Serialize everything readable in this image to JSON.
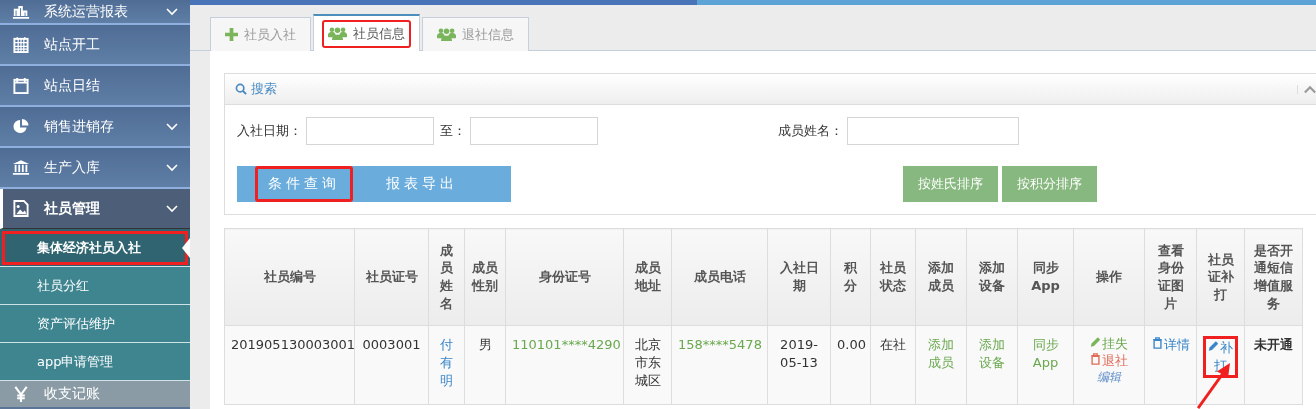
{
  "sidebar": {
    "items": [
      {
        "label": "系统运营报表",
        "expandable": true,
        "expanded": false
      },
      {
        "label": "站点开工",
        "expandable": false,
        "expanded": false
      },
      {
        "label": "站点日结",
        "expandable": false,
        "expanded": false
      },
      {
        "label": "销售进销存",
        "expandable": true,
        "expanded": false
      },
      {
        "label": "生产入库",
        "expandable": true,
        "expanded": false
      },
      {
        "label": "社员管理",
        "expandable": true,
        "expanded": true,
        "children": [
          {
            "label": "集体经济社员入社",
            "selected": true,
            "annotated": true
          },
          {
            "label": "社员分红",
            "selected": false,
            "annotated": false
          },
          {
            "label": "资产评估维护",
            "selected": false,
            "annotated": false
          },
          {
            "label": "app申请管理",
            "selected": false,
            "annotated": false
          }
        ]
      },
      {
        "label": "收支记账",
        "expandable": false,
        "expanded": false
      }
    ]
  },
  "tabs": [
    {
      "label": "社员入社",
      "selected": false,
      "annotated": false
    },
    {
      "label": "社员信息",
      "selected": true,
      "annotated": true
    },
    {
      "label": "退社信息",
      "selected": false,
      "annotated": false
    }
  ],
  "search": {
    "title": "搜索",
    "fields": [
      {
        "label": "入社日期："
      },
      {
        "label": "至："
      },
      {
        "label": "成员姓名："
      }
    ],
    "buttons": [
      {
        "label": "条件查询",
        "kind": "primary",
        "annotated": true
      },
      {
        "label": "报表导出",
        "kind": "primary",
        "annotated": false
      },
      {
        "label": "按姓氏排序",
        "kind": "success",
        "annotated": false
      },
      {
        "label": "按积分排序",
        "kind": "success",
        "annotated": false
      }
    ]
  },
  "table": {
    "columns": [
      "社员编号",
      "社员证号",
      "成员姓名",
      "成员性别",
      "身份证号",
      "成员地址",
      "成员电话",
      "入社日期",
      "积分",
      "社员状态",
      "添加成员",
      "添加设备",
      "同步App",
      "操作",
      "查看身份证图片",
      "社员证补打",
      "是否开通短信增值服务"
    ],
    "rows": [
      {
        "cells": [
          {
            "kind": "text",
            "text": "201905130003001"
          },
          {
            "kind": "text",
            "text": "0003001"
          },
          {
            "kind": "link",
            "text": "付有明"
          },
          {
            "kind": "text",
            "text": "男"
          },
          {
            "kind": "green",
            "text": "110101****4290"
          },
          {
            "kind": "text",
            "text": "北京市东城区"
          },
          {
            "kind": "green",
            "text": "158****5478"
          },
          {
            "kind": "text",
            "text": "2019-05-13"
          },
          {
            "kind": "text",
            "text": "0.00"
          },
          {
            "kind": "text",
            "text": "在社"
          },
          {
            "kind": "green",
            "text": "添加成员"
          },
          {
            "kind": "green",
            "text": "添加设备"
          },
          {
            "kind": "green",
            "text": "同步App"
          },
          {
            "kind": "actions",
            "links": [
              {
                "kind": "report-loss",
                "text": "挂失"
              },
              {
                "kind": "quit",
                "text": "退社"
              },
              {
                "kind": "edit",
                "text": "编辑"
              }
            ]
          },
          {
            "kind": "detail",
            "text": "详情"
          },
          {
            "kind": "reprint",
            "text": "补打",
            "annotated": true
          },
          {
            "kind": "bold",
            "text": "未开通"
          }
        ]
      }
    ]
  }
}
